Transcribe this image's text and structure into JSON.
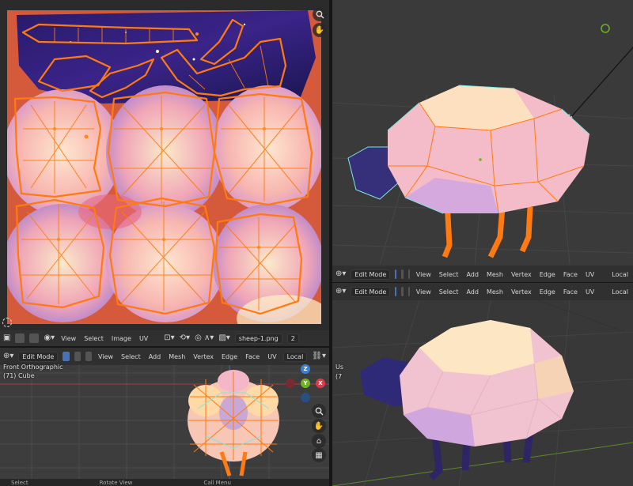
{
  "uv_editor": {
    "menu": {
      "view": "View",
      "select": "Select",
      "image": "Image",
      "uv": "UV"
    },
    "image_name": "sheep-1.png",
    "image_users": "2"
  },
  "viewport_front": {
    "mode": "Edit Mode",
    "menu": {
      "view": "View",
      "select": "Select",
      "add": "Add",
      "mesh": "Mesh",
      "vertex": "Vertex",
      "edge": "Edge",
      "face": "Face",
      "uv": "UV"
    },
    "orientation": "Local",
    "view_name": "Front Orthographic",
    "object_info": "(71) Cube",
    "gizmo": {
      "z": "Z",
      "y": "Y",
      "x": "X"
    }
  },
  "viewport_top_right": {
    "mode": "Edit Mode",
    "menu": {
      "view": "View",
      "select": "Select",
      "add": "Add",
      "mesh": "Mesh",
      "vertex": "Vertex",
      "edge": "Edge",
      "face": "Face",
      "uv": "UV"
    },
    "orientation": "Local"
  },
  "viewport_bottom_right": {
    "mode": "Edit Mode",
    "menu": {
      "view": "View",
      "select": "Select",
      "add": "Add",
      "mesh": "Mesh",
      "vertex": "Vertex",
      "edge": "Edge",
      "face": "Face",
      "uv": "UV"
    },
    "orientation": "Local",
    "view_name": "Us",
    "object_info": "(7"
  },
  "status_bar": {
    "select": "Select",
    "rotate": "Rotate View",
    "menu": "Call Menu"
  },
  "colors": {
    "accent": "#4772b3",
    "uv_bg": "#d55a3c",
    "edge_orange": "#ff7a10",
    "edge_cyan": "#7fe6e0",
    "x_axis": "#e03a48",
    "y_axis": "#6bb524",
    "z_axis": "#3b7fd9"
  },
  "icons": [
    "zoom-icon",
    "hand-pan-icon",
    "camera-icon",
    "grid-icon",
    "pin-icon",
    "editor-type-icon"
  ]
}
